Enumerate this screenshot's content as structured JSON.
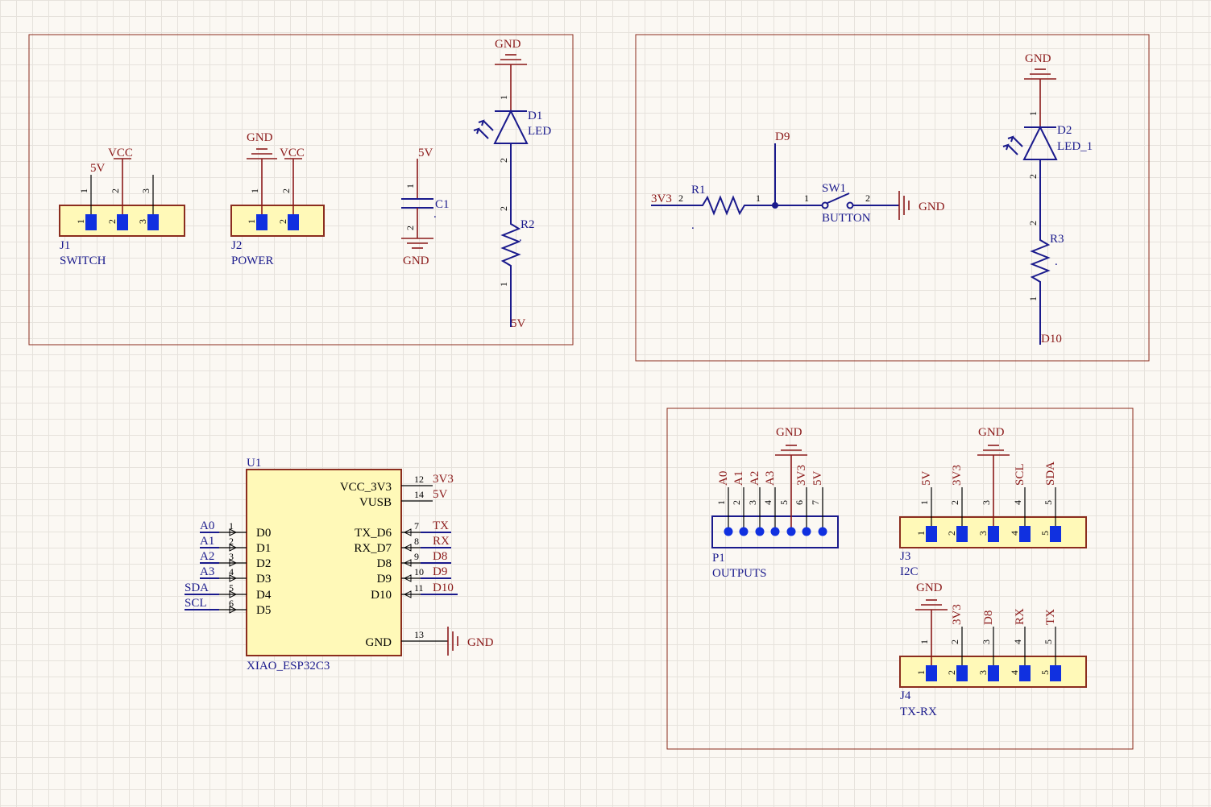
{
  "nets": {
    "gnd": "GND",
    "vcc": "VCC",
    "v5": "5V",
    "v3v3": "3V3",
    "d9": "D9",
    "d10": "D10",
    "d8": "D8",
    "tx": "TX",
    "rx": "RX",
    "a0": "A0",
    "a1": "A1",
    "a2": "A2",
    "a3": "A3",
    "sda": "SDA",
    "scl": "SCL"
  },
  "j1": {
    "ref": "J1",
    "value": "SWITCH",
    "pins": [
      "1",
      "2",
      "3"
    ]
  },
  "j2": {
    "ref": "J2",
    "value": "POWER",
    "pins": [
      "1",
      "2"
    ]
  },
  "c1": {
    "ref": "C1",
    "value": ".",
    "pins": [
      "1",
      "2"
    ]
  },
  "d1": {
    "ref": "D1",
    "value": "LED",
    "pins": [
      "1",
      "2"
    ]
  },
  "r2": {
    "ref": "R2",
    "value": ".",
    "pins": [
      "1",
      "2"
    ]
  },
  "r1": {
    "ref": "R1",
    "value": ".",
    "pins": [
      "1",
      "2"
    ]
  },
  "sw1": {
    "ref": "SW1",
    "value": "BUTTON",
    "pins": [
      "1",
      "2"
    ]
  },
  "d2": {
    "ref": "D2",
    "value": "LED_1",
    "pins": [
      "1",
      "2"
    ]
  },
  "r3": {
    "ref": "R3",
    "value": ".",
    "pins": [
      "1",
      "2"
    ]
  },
  "u1": {
    "ref": "U1",
    "value": "XIAO_ESP32C3",
    "left_pins": [
      {
        "num": "1",
        "name": "D0",
        "net": "A0"
      },
      {
        "num": "2",
        "name": "D1",
        "net": "A1"
      },
      {
        "num": "3",
        "name": "D2",
        "net": "A2"
      },
      {
        "num": "4",
        "name": "D3",
        "net": "A3"
      },
      {
        "num": "5",
        "name": "D4",
        "net": "SDA"
      },
      {
        "num": "6",
        "name": "D5",
        "net": "SCL"
      }
    ],
    "right_pins": [
      {
        "num": "12",
        "name": "VCC_3V3",
        "net": "3V3"
      },
      {
        "num": "14",
        "name": "VUSB",
        "net": "5V"
      },
      {
        "num": "7",
        "name": "TX_D6",
        "net": "TX"
      },
      {
        "num": "8",
        "name": "RX_D7",
        "net": "RX"
      },
      {
        "num": "9",
        "name": "D8",
        "net": "D8"
      },
      {
        "num": "10",
        "name": "D9",
        "net": "D9"
      },
      {
        "num": "11",
        "name": "D10",
        "net": "D10"
      },
      {
        "num": "13",
        "name": "GND",
        "net": "GND"
      }
    ]
  },
  "p1": {
    "ref": "P1",
    "value": "OUTPUTS",
    "pins": [
      "1",
      "2",
      "3",
      "4",
      "5",
      "6",
      "7"
    ],
    "nets": [
      "A0",
      "A1",
      "A2",
      "A3",
      "3V3",
      "5V"
    ]
  },
  "j3": {
    "ref": "J3",
    "value": "I2C",
    "pins": [
      "1",
      "2",
      "3",
      "4",
      "5"
    ],
    "nets": [
      "5V",
      "3V3",
      "SCL",
      "SDA"
    ]
  },
  "j4": {
    "ref": "J4",
    "value": "TX-RX",
    "pins": [
      "1",
      "2",
      "3",
      "4",
      "5"
    ],
    "nets": [
      "3V3",
      "D8",
      "RX",
      "TX"
    ]
  }
}
